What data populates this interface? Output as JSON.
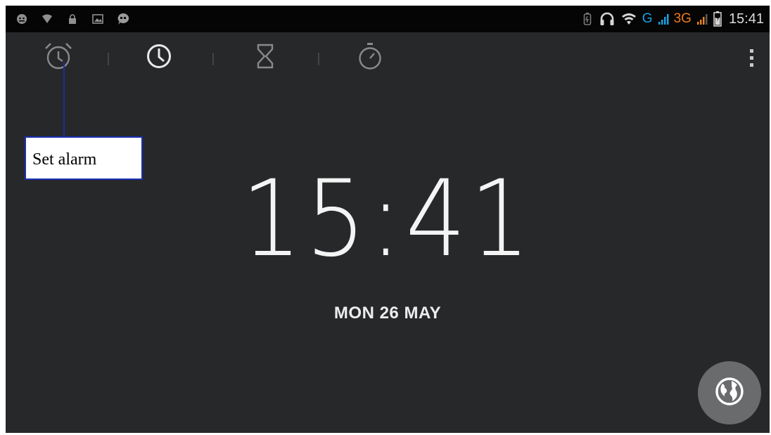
{
  "status_bar": {
    "left_icons": [
      "android-debug-icon",
      "wifi-small-icon",
      "lock-icon",
      "image-icon",
      "chat-icon"
    ],
    "right_icons": [
      "battery-saver-icon",
      "headset-icon",
      "wifi-icon"
    ],
    "network_g": "G",
    "network_3g": "3G",
    "time": "15:41",
    "colors": {
      "g": "#1aa1e0",
      "three_g": "#f07a1a",
      "signal": "#e8821e"
    }
  },
  "tabs": [
    {
      "name": "alarm-tab",
      "icon": "alarm-clock-icon",
      "selected": false
    },
    {
      "name": "clock-tab",
      "icon": "clock-icon",
      "selected": true
    },
    {
      "name": "timer-tab",
      "icon": "hourglass-icon",
      "selected": false
    },
    {
      "name": "stopwatch-tab",
      "icon": "stopwatch-icon",
      "selected": false
    }
  ],
  "overflow_menu": {
    "icon": "more-vert-icon"
  },
  "clock": {
    "time": "15:41",
    "date": "MON 26 MAY"
  },
  "world_button": {
    "icon": "globe-icon"
  },
  "annotation": {
    "label": "Set alarm",
    "color": "#1a2fb3"
  }
}
